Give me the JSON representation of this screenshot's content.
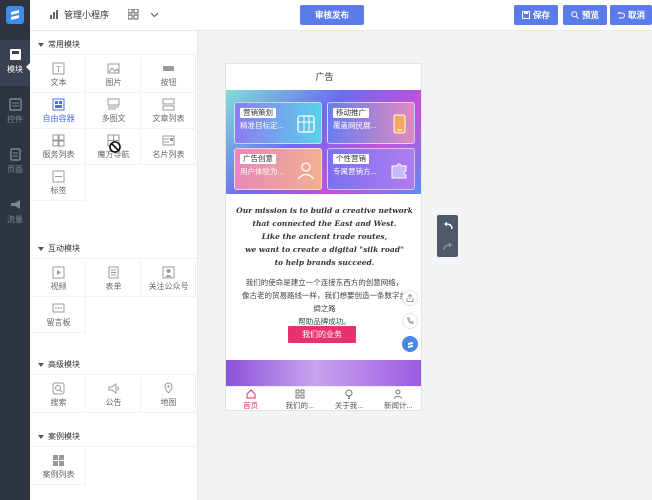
{
  "topbar": {
    "app_title": "管理小程序",
    "publish_label": "审核发布",
    "save_label": "保存",
    "preview_label": "预览",
    "cancel_label": "取消"
  },
  "rail": {
    "items": [
      {
        "label": "模块"
      },
      {
        "label": "控件"
      },
      {
        "label": "页面"
      },
      {
        "label": "流量"
      }
    ]
  },
  "panel": {
    "sections": [
      {
        "title": "常用模块",
        "items": [
          {
            "label": "文本",
            "icon": "text-icon"
          },
          {
            "label": "图片",
            "icon": "image-icon"
          },
          {
            "label": "按钮",
            "icon": "button-icon"
          },
          {
            "label": "自由容器",
            "icon": "container-icon"
          },
          {
            "label": "多图文",
            "icon": "multi-image-text-icon"
          },
          {
            "label": "文章列表",
            "icon": "article-list-icon"
          },
          {
            "label": "服务列表",
            "icon": "service-list-icon"
          },
          {
            "label": "魔方导航",
            "icon": "cube-nav-icon"
          },
          {
            "label": "名片列表",
            "icon": "card-list-icon"
          },
          {
            "label": "标签",
            "icon": "tag-icon"
          }
        ]
      },
      {
        "title": "互动模块",
        "items": [
          {
            "label": "视频",
            "icon": "video-icon"
          },
          {
            "label": "表单",
            "icon": "form-icon"
          },
          {
            "label": "关注公众号",
            "icon": "follow-icon"
          },
          {
            "label": "留言板",
            "icon": "message-board-icon"
          }
        ]
      },
      {
        "title": "高级模块",
        "items": [
          {
            "label": "搜索",
            "icon": "search-icon"
          },
          {
            "label": "公告",
            "icon": "announcement-icon"
          },
          {
            "label": "地图",
            "icon": "map-icon"
          }
        ]
      },
      {
        "title": "案例模块",
        "items": [
          {
            "label": "案例列表",
            "icon": "case-list-icon"
          }
        ]
      }
    ]
  },
  "phone": {
    "title": "广告",
    "cards": [
      {
        "title": "营销策划",
        "sub": "精准目标定..."
      },
      {
        "title": "移动推广",
        "sub": "覆盖网民展..."
      },
      {
        "title": "广告创意",
        "sub": "用户体验为..."
      },
      {
        "title": "个性营销",
        "sub": "专属营销方..."
      }
    ],
    "mission_en": [
      "Our mission is to build a creative network",
      "that connected the East and West.",
      "Like the ancient trade routes,",
      "we want to create a digital \"silk road\"",
      "to help brands succeed."
    ],
    "mission_cn": [
      "我们的使命是建立一个连接东西方的创意网络，",
      "像古老的贸易路线一样，我们想要创造一条数字丝",
      "绸之路",
      "帮助品牌成功。"
    ],
    "cta_label": "我们的业务",
    "tabs": [
      {
        "label": "首页"
      },
      {
        "label": "我们的..."
      },
      {
        "label": "关于我..."
      },
      {
        "label": "新闻计..."
      }
    ]
  },
  "colors": {
    "accent": "#5b7ce8",
    "cta": "#e6336e",
    "rail_bg": "#2e3440"
  }
}
